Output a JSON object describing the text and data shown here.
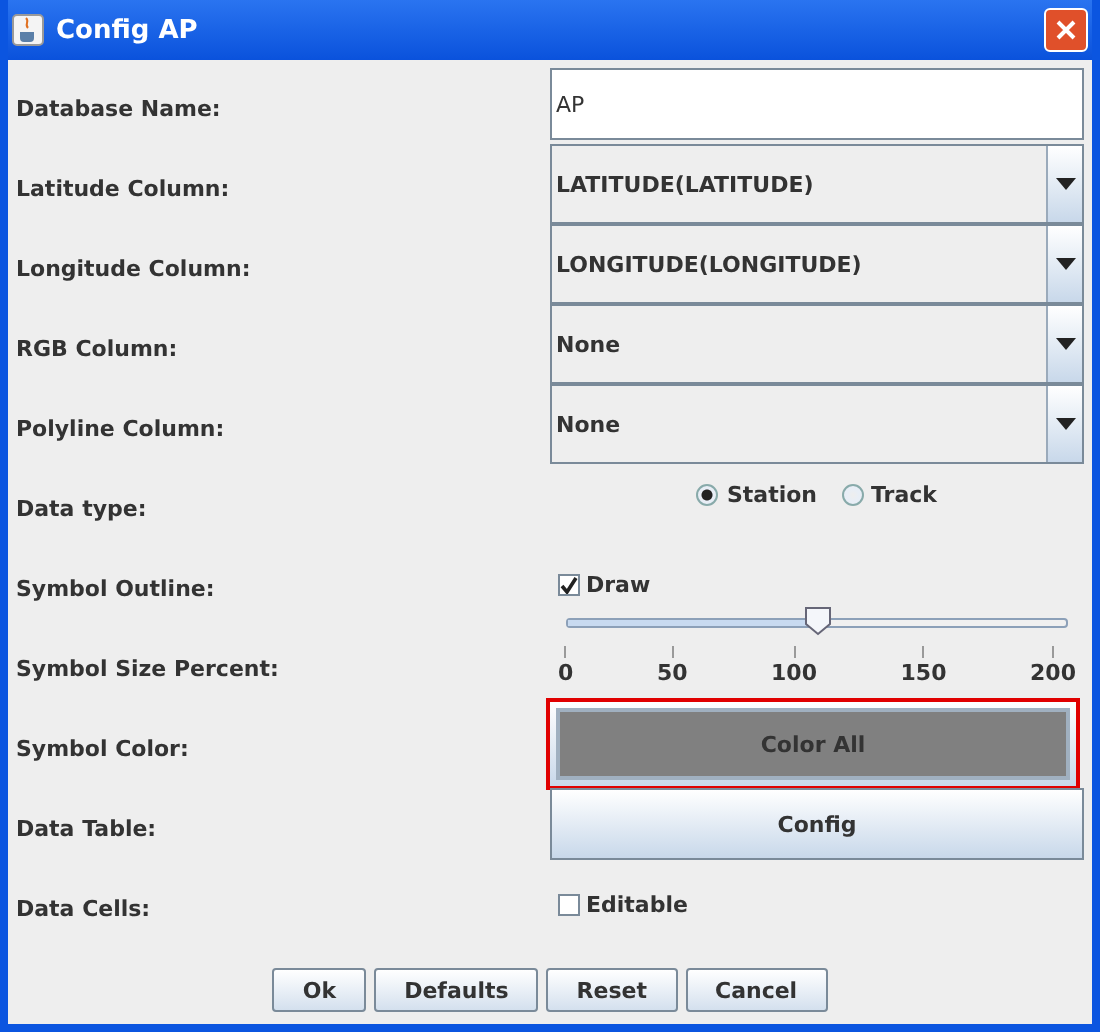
{
  "window": {
    "title": "Config AP"
  },
  "rows": [
    {
      "label": "Database Name:",
      "kind": "text",
      "value": "AP"
    },
    {
      "label": "Latitude Column:",
      "kind": "combo",
      "value": "LATITUDE(LATITUDE)"
    },
    {
      "label": "Longitude Column:",
      "kind": "combo",
      "value": "LONGITUDE(LONGITUDE)"
    },
    {
      "label": "RGB Column:",
      "kind": "combo",
      "value": "None"
    },
    {
      "label": "Polyline Column:",
      "kind": "combo",
      "value": "None"
    },
    {
      "label": "Data type:",
      "kind": "radio",
      "options": [
        {
          "label": "Station",
          "selected": true
        },
        {
          "label": "Track",
          "selected": false
        }
      ]
    },
    {
      "label": "Symbol Outline:",
      "kind": "checkbox",
      "text": "Draw",
      "checked": true
    },
    {
      "label": "Symbol Size Percent:",
      "kind": "slider",
      "level": 0.5,
      "ticks": [
        "0",
        "50",
        "100",
        "150",
        "200"
      ]
    },
    {
      "label": "Symbol Color:",
      "kind": "button",
      "text": "Color All",
      "color": "#808080",
      "highlighted": true
    },
    {
      "label": "Data Table:",
      "kind": "button",
      "text": "Config",
      "highlighted": false
    },
    {
      "label": "Data Cells:",
      "kind": "checkbox",
      "text": "Editable",
      "checked": false
    }
  ],
  "buttons": [
    "Ok",
    "Defaults",
    "Reset",
    "Cancel"
  ]
}
